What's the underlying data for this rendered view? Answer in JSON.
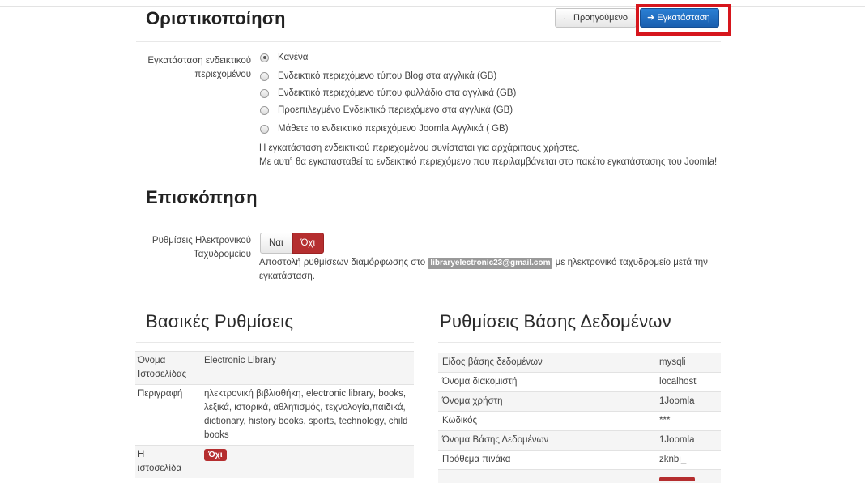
{
  "header": {
    "title": "Οριστικοποίηση",
    "prev_button": "← Προηγούμενο",
    "install_button": "➜ Εγκατάσταση"
  },
  "sample_data": {
    "label_line1": "Εγκατάσταση ενδεικτικού",
    "label_line2": "περιεχομένου",
    "options": [
      {
        "label": "Κανένα",
        "selected": true
      },
      {
        "label": "Ενδεικτικό περιεχόμενο τύπου Blog στα αγγλικά (GB)",
        "selected": false
      },
      {
        "label": "Ενδεικτικό περιεχόμενο τύπου φυλλάδιο στα αγγλικά (GB)",
        "selected": false
      },
      {
        "label": "Προεπιλεγμένο Ενδεικτικό περιεχόμενο στα αγγλικά (GB)",
        "selected": false
      },
      {
        "label": "Μάθετε το ενδεικτικό περιεχόμενο Joomla Αγγλικά ( GB)",
        "selected": false
      }
    ],
    "help_line1": "Η εγκατάσταση ενδεικτικού περιεχομένου συνίσταται για αρχάριπους χρήστες.",
    "help_line2": "Με αυτή θα εγκατασταθεί το ενδεικτικό περιεχόμενο που περιλαμβάνεται στο πακέτο εγκατάστασης του Joomla!"
  },
  "overview": {
    "title": "Επισκόπηση",
    "email_label_line1": "Ρυθμίσεις Ηλεκτρονικού",
    "email_label_line2": "Ταχυδρομείου",
    "toggle_yes": "Ναι",
    "toggle_no": "Όχι",
    "help_before": "Αποστολή ρυθμίσεων διαμόρφωσης στο",
    "email": "libraryelectronic23@gmail.com",
    "help_after": "με ηλεκτρονικό ταχυδρομείο μετά την",
    "help_line2": "εγκατάσταση."
  },
  "basic": {
    "title": "Βασικές Ρυθμίσεις",
    "site_name_label_1": "Όνομα",
    "site_name_label_2": "Ιστοσελίδας",
    "site_name_value": "Electronic Library",
    "description_label": "Περιγραφή",
    "description_line1": "ηλεκτρονική βιβλιοθήκη, electronic library, books,",
    "description_line2": "λεξικά, ιστορικά, αθλητισμός, τεχνολογία,παιδικά,",
    "description_line3": "dictionary, history books, sports, technology, child",
    "description_line4": "books",
    "offline_label_1": "Η",
    "offline_label_2": "ιστοσελίδα",
    "offline_value": "Όχι"
  },
  "database": {
    "title": "Ρυθμίσεις Βάσης Δεδομένων",
    "rows": [
      {
        "label": "Είδος βάσης δεδομένων",
        "value": "mysqli"
      },
      {
        "label": "Όνομα διακομιστή",
        "value": "localhost"
      },
      {
        "label": "Όνομα χρήστη",
        "value": "1Joomla"
      },
      {
        "label": "Κωδικός",
        "value": "***"
      },
      {
        "label": "Όνομα Βάσης Δεδομένων",
        "value": "1Joomla"
      },
      {
        "label": "Πρόθεμα πινάκα",
        "value": "zknbi_"
      }
    ]
  },
  "colors": {
    "install_blue": "#1f6cc2",
    "danger_red": "#b52e2f",
    "highlight_box": "#d6161d"
  }
}
